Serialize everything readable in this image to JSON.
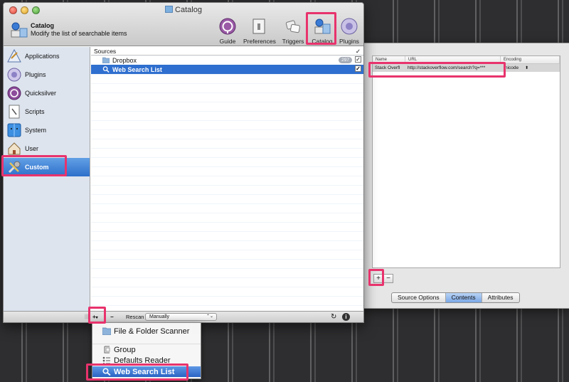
{
  "window": {
    "title": "Catalog"
  },
  "header": {
    "title": "Catalog",
    "subtitle": "Modify the list of searchable items"
  },
  "toolbar": [
    {
      "label": "Guide",
      "icon": "guide-icon"
    },
    {
      "label": "Preferences",
      "icon": "preferences-icon"
    },
    {
      "label": "Triggers",
      "icon": "triggers-icon"
    },
    {
      "label": "Catalog",
      "icon": "catalog-icon",
      "selected": true
    },
    {
      "label": "Plugins",
      "icon": "plugins-icon"
    }
  ],
  "sidebar": {
    "items": [
      {
        "label": "Applications",
        "icon": "applications-icon"
      },
      {
        "label": "Plugins",
        "icon": "plugins-icon"
      },
      {
        "label": "Quicksilver",
        "icon": "quicksilver-icon"
      },
      {
        "label": "Scripts",
        "icon": "scripts-icon"
      },
      {
        "label": "System",
        "icon": "system-icon"
      },
      {
        "label": "User",
        "icon": "user-icon"
      },
      {
        "label": "Custom",
        "icon": "custom-icon",
        "selected": true
      }
    ]
  },
  "sources": {
    "header": "Sources",
    "check_header": "✓",
    "rows": [
      {
        "label": "Dropbox",
        "badge": "297",
        "checked": true
      },
      {
        "label": "Web Search List",
        "checked": true,
        "selected": true
      }
    ]
  },
  "bottombar": {
    "add_label": "+",
    "add_arrow": "▾",
    "remove_label": "−",
    "rescan_label": "Rescan",
    "rescan_value": "Manually",
    "rescan_arrow": "⌃⌄",
    "refresh_glyph": "↻",
    "info_glyph": "i"
  },
  "add_menu": {
    "items": [
      {
        "label": "File & Folder Scanner",
        "icon": "folder-icon"
      },
      {
        "label": "Group",
        "icon": "group-icon"
      },
      {
        "label": "Defaults Reader",
        "icon": "defaults-reader-icon"
      },
      {
        "label": "Web Search List",
        "icon": "magnifier-icon",
        "selected": true
      }
    ]
  },
  "detail": {
    "columns": [
      "Name",
      "URL",
      "Encoding"
    ],
    "rows": [
      {
        "name": "Stack Overfl",
        "url": "http://stackoverflow.com/search?q=***",
        "encoding": "nicode"
      }
    ],
    "add_label": "+",
    "remove_label": "−",
    "tabs": [
      {
        "label": "Source Options"
      },
      {
        "label": "Contents",
        "selected": true
      },
      {
        "label": "Attributes"
      }
    ]
  },
  "colors": {
    "highlight": "#e8336d",
    "selection": "#2f6fcf"
  }
}
